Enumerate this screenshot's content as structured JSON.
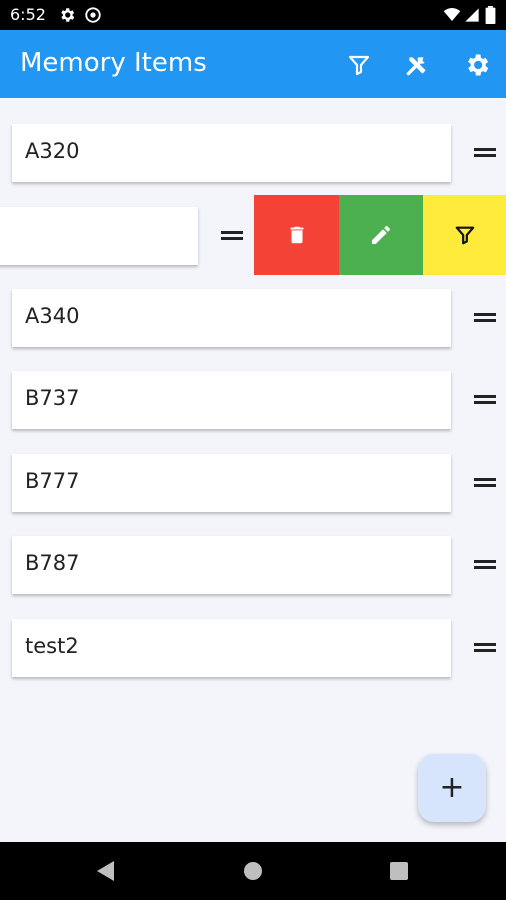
{
  "status_bar": {
    "time": "6:52",
    "icons": [
      "gear-icon",
      "vpn-icon",
      "wifi-icon",
      "signal-icon",
      "battery-icon"
    ]
  },
  "app_bar": {
    "title": "Memory Items",
    "actions": [
      "filter-icon",
      "tools-icon",
      "settings-icon"
    ],
    "color": "#2196f3"
  },
  "items": [
    {
      "label": "A320"
    },
    {
      "label": ""
    },
    {
      "label": "A340"
    },
    {
      "label": "B737"
    },
    {
      "label": "B777"
    },
    {
      "label": "B787"
    },
    {
      "label": "test2"
    }
  ],
  "swipe_actions": [
    {
      "name": "delete",
      "icon": "trash-icon",
      "color": "#f44336"
    },
    {
      "name": "edit",
      "icon": "pencil-icon",
      "color": "#4caf50"
    },
    {
      "name": "filter",
      "icon": "filter-icon",
      "color": "#ffeb3b"
    }
  ],
  "fab": {
    "label": "+"
  },
  "nav_bar": {
    "buttons": [
      "back-icon",
      "home-icon",
      "recents-icon"
    ]
  }
}
